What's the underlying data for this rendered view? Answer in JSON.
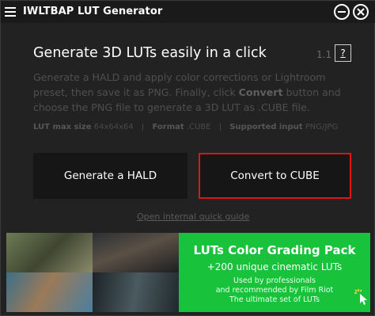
{
  "window": {
    "title": "IWLTBAP LUT Generator",
    "minimize_icon": "minimize-icon",
    "close_icon": "close-icon"
  },
  "header": {
    "heading": "Generate 3D LUTs easily in a click",
    "version": "1.1",
    "help_label": "?"
  },
  "description": {
    "part1": "Generate a HALD and apply color corrections or Lightroom preset, then save it as PNG. Finally, click ",
    "bold": "Convert",
    "part2": " button and choose the PNG file to generate a 3D LUT as .CUBE file."
  },
  "specs": {
    "size_label": "LUT max size",
    "size_value": "64x64x64",
    "format_label": "Format",
    "format_value": ".CUBE",
    "input_label": "Supported input",
    "input_value": "PNG/JPG",
    "separator": "|"
  },
  "buttons": {
    "hald": "Generate a HALD",
    "cube": "Convert to CUBE"
  },
  "guide_link": "Open internal quick guide",
  "banner": {
    "title": "LUTs Color Grading Pack",
    "subtitle": "+200 unique cinematic LUTs",
    "line1": "Used by professionals",
    "line2": "and recommended by Film Riot",
    "line3": "The ultimate set of LUTs"
  },
  "colors": {
    "highlight_border": "#e01414",
    "banner_green": "#18c23a",
    "background": "#222222"
  }
}
